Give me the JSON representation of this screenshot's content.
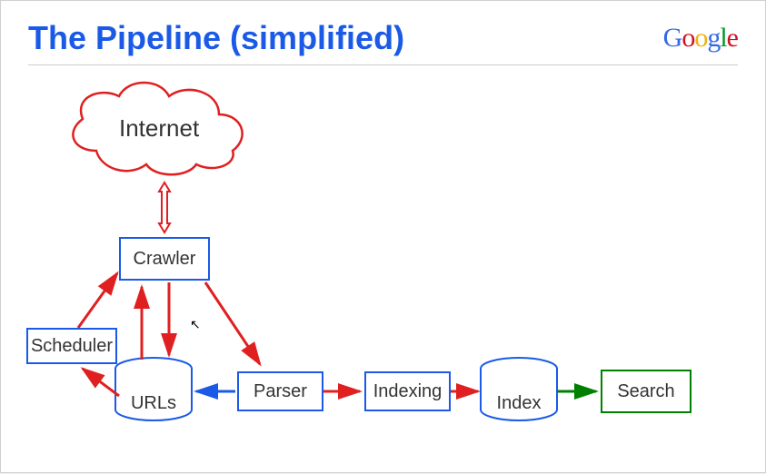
{
  "header": {
    "title": "The Pipeline (simplified)",
    "logo": {
      "letters": [
        {
          "c": "G",
          "cls": "g-b"
        },
        {
          "c": "o",
          "cls": "g-r"
        },
        {
          "c": "o",
          "cls": "g-y"
        },
        {
          "c": "g",
          "cls": "g-b"
        },
        {
          "c": "l",
          "cls": "g-g"
        },
        {
          "c": "e",
          "cls": "g-r"
        }
      ]
    }
  },
  "nodes": {
    "internet": "Internet",
    "crawler": "Crawler",
    "scheduler": "Scheduler",
    "urls": "URLs",
    "parser": "Parser",
    "indexing": "Indexing",
    "index": "Index",
    "search": "Search"
  },
  "diagram": {
    "description": "Simplified web crawling/indexing pipeline",
    "flow": [
      {
        "from": "Internet",
        "to": "Crawler",
        "type": "bidirectional",
        "color": "red"
      },
      {
        "from": "Crawler",
        "to": "URLs",
        "type": "directed",
        "color": "red"
      },
      {
        "from": "Crawler",
        "to": "Parser",
        "type": "directed",
        "color": "red"
      },
      {
        "from": "URLs",
        "to": "Crawler",
        "type": "directed",
        "color": "red"
      },
      {
        "from": "URLs",
        "to": "Scheduler",
        "type": "directed",
        "color": "red"
      },
      {
        "from": "Scheduler",
        "to": "Crawler",
        "type": "directed",
        "color": "red"
      },
      {
        "from": "Parser",
        "to": "URLs",
        "type": "directed",
        "color": "blue"
      },
      {
        "from": "Parser",
        "to": "Indexing",
        "type": "directed",
        "color": "red"
      },
      {
        "from": "Indexing",
        "to": "Index",
        "type": "directed",
        "color": "red"
      },
      {
        "from": "Index",
        "to": "Search",
        "type": "directed",
        "color": "green"
      }
    ]
  }
}
